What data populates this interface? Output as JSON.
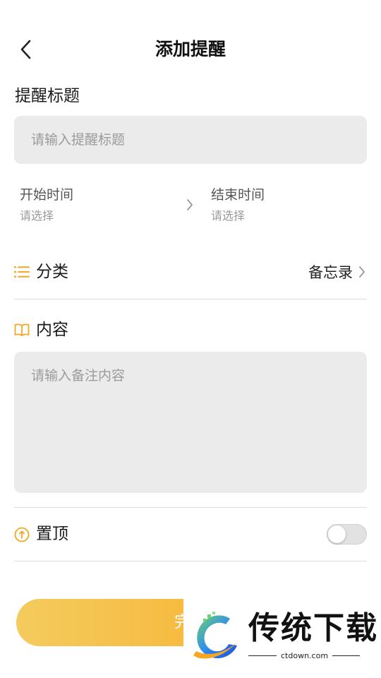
{
  "header": {
    "title": "添加提醒",
    "back_icon": "chevron-left-icon"
  },
  "title_section": {
    "label": "提醒标题",
    "placeholder": "请输入提醒标题",
    "value": ""
  },
  "time": {
    "start": {
      "label": "开始时间",
      "value": "请选择"
    },
    "end": {
      "label": "结束时间",
      "value": "请选择"
    }
  },
  "category": {
    "icon": "list-icon",
    "label": "分类",
    "value": "备忘录"
  },
  "content": {
    "icon": "book-icon",
    "label": "内容",
    "placeholder": "请输入备注内容",
    "value": ""
  },
  "pin_top": {
    "icon": "arrow-up-circle-icon",
    "label": "置顶",
    "enabled": false
  },
  "done_button": {
    "label": "完成"
  },
  "watermark": {
    "brand": "传统下载",
    "url": "ctdown.com"
  },
  "colors": {
    "accent": "#f6a623",
    "input_bg": "#ebebeb",
    "divider": "#dcdcdc"
  }
}
